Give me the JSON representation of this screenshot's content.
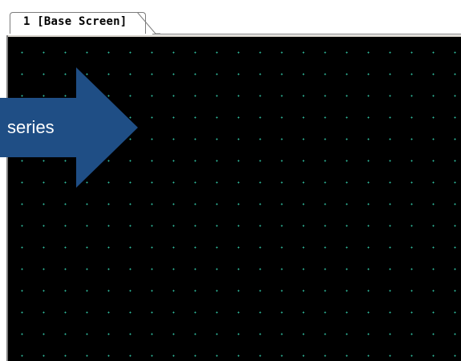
{
  "tabs": [
    {
      "label": "1 [Base Screen]",
      "selected": true
    }
  ],
  "canvas": {
    "background": "#000000",
    "grid_dot_color": "#2fbfa0"
  },
  "callout": {
    "label": "series",
    "color": "#1f4e85"
  }
}
